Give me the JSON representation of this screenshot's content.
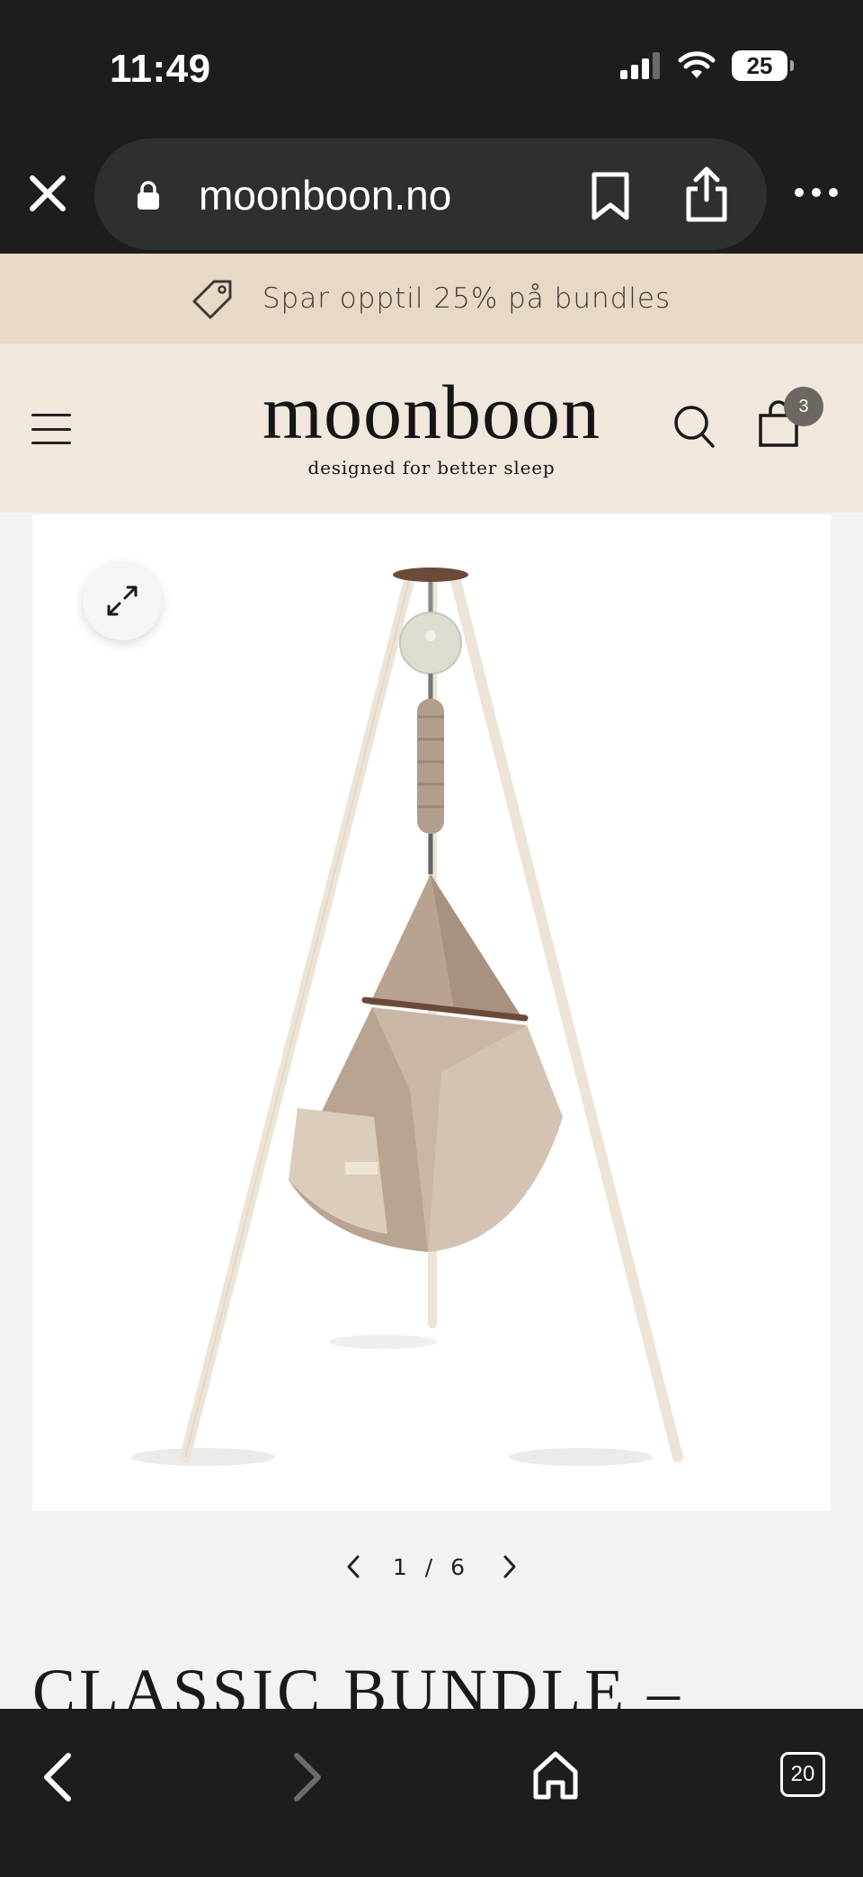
{
  "status": {
    "time": "11:49",
    "battery": "25"
  },
  "browser": {
    "url": "moonboon.no",
    "tab_count": "20"
  },
  "promo": {
    "text": "Spar opptil 25% på bundles"
  },
  "header": {
    "logo": "moonboon",
    "tagline": "designed for better sleep",
    "cart_count": "3"
  },
  "gallery": {
    "current": "1",
    "separator": "/",
    "total": "6"
  },
  "product": {
    "title_peek": "CLASSIC BUNDLE –"
  },
  "icons": {
    "close": "close-icon",
    "lock": "lock-icon",
    "bookmark": "bookmark-icon",
    "share": "share-icon",
    "more": "more-icon",
    "tag": "tag-icon",
    "menu": "menu-icon",
    "search": "search-icon",
    "cart": "cart-icon",
    "expand": "expand-icon",
    "back": "back-icon",
    "forward": "forward-icon",
    "home": "home-icon",
    "tabs": "tabs-icon"
  },
  "colors": {
    "promo_bg": "#e8d9c6",
    "header_bg": "#f0e7dd",
    "browser_bg": "#1d1d1e",
    "page_bg": "#f3f2f1"
  }
}
